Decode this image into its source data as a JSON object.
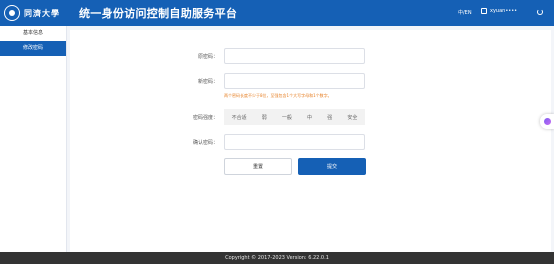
{
  "header": {
    "logo_text": "同濟大學",
    "title": "统一身份访问控制自助服务平台",
    "lang": "中/EN",
    "user": "xyuan••••"
  },
  "sidebar": {
    "items": [
      {
        "label": "基本信息"
      },
      {
        "label": "修改密码"
      }
    ]
  },
  "form": {
    "old_password_label": "原密码：",
    "new_password_label": "新密码：",
    "hint": "两个密码长度不少于8位，至强包含1个大写字母和1个数字。",
    "strength_label": "密码强度：",
    "strength_levels": [
      "不合适",
      "弱",
      "一般",
      "中",
      "强",
      "安全"
    ],
    "confirm_label": "确认密码：",
    "reset_label": "重置",
    "submit_label": "提交"
  },
  "footer": {
    "text": "Copyright © 2017-2023 Version: 6.22.0.1"
  }
}
